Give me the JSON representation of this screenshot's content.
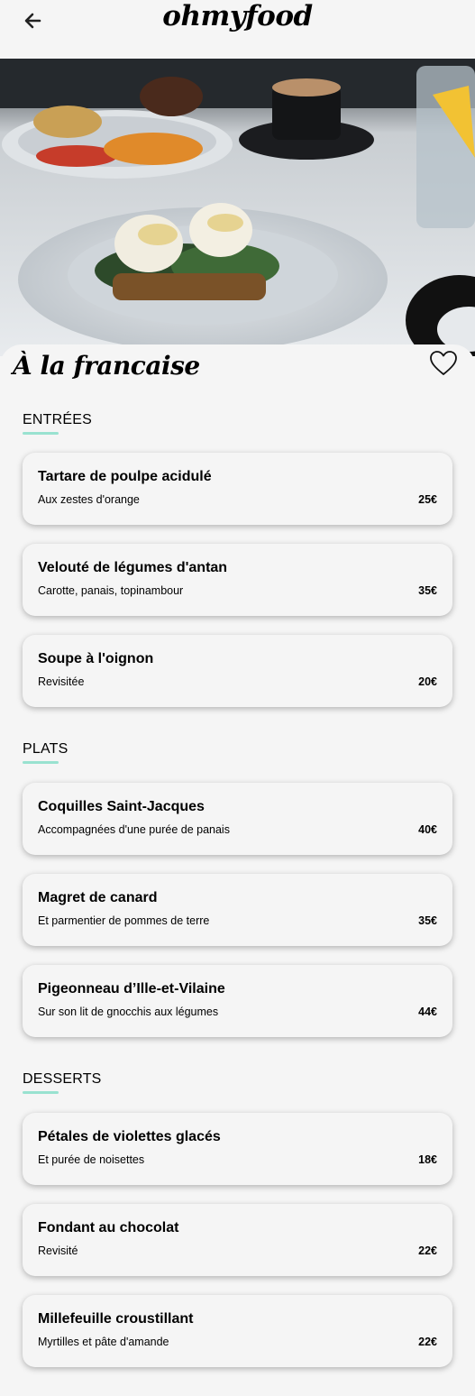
{
  "header": {
    "logo": "ohmyfood",
    "back_icon": "arrow-left-icon"
  },
  "restaurant": {
    "title": "À la francaise",
    "favorite_icon": "heart-outline-icon"
  },
  "sections": [
    {
      "title": "ENTRÉES",
      "items": [
        {
          "name": "Tartare de poulpe acidulé",
          "description": "Aux zestes d'orange",
          "price": "25€"
        },
        {
          "name": "Velouté de légumes d'antan",
          "description": "Carotte, panais, topinambour",
          "price": "35€"
        },
        {
          "name": "Soupe à l'oignon",
          "description": "Revisitée",
          "price": "20€"
        }
      ]
    },
    {
      "title": "PLATS",
      "items": [
        {
          "name": "Coquilles Saint-Jacques",
          "description": "Accompagnées d'une purée de panais",
          "price": "40€"
        },
        {
          "name": "Magret de canard",
          "description": "Et parmentier de pommes de terre",
          "price": "35€"
        },
        {
          "name": "Pigeonneau d’Ille-et-Vilaine",
          "description": "Sur son lit de gnocchis aux légumes",
          "price": "44€"
        }
      ]
    },
    {
      "title": "DESSERTS",
      "items": [
        {
          "name": "Pétales de violettes glacés",
          "description": "Et purée de noisettes",
          "price": "18€"
        },
        {
          "name": "Fondant au chocolat",
          "description": "Revisité",
          "price": "22€"
        },
        {
          "name": "Millefeuille croustillant",
          "description": "Myrtilles et pâte d'amande",
          "price": "22€"
        }
      ]
    }
  ],
  "colors": {
    "background": "#f5f5f5",
    "accent": "#99e2d0"
  }
}
